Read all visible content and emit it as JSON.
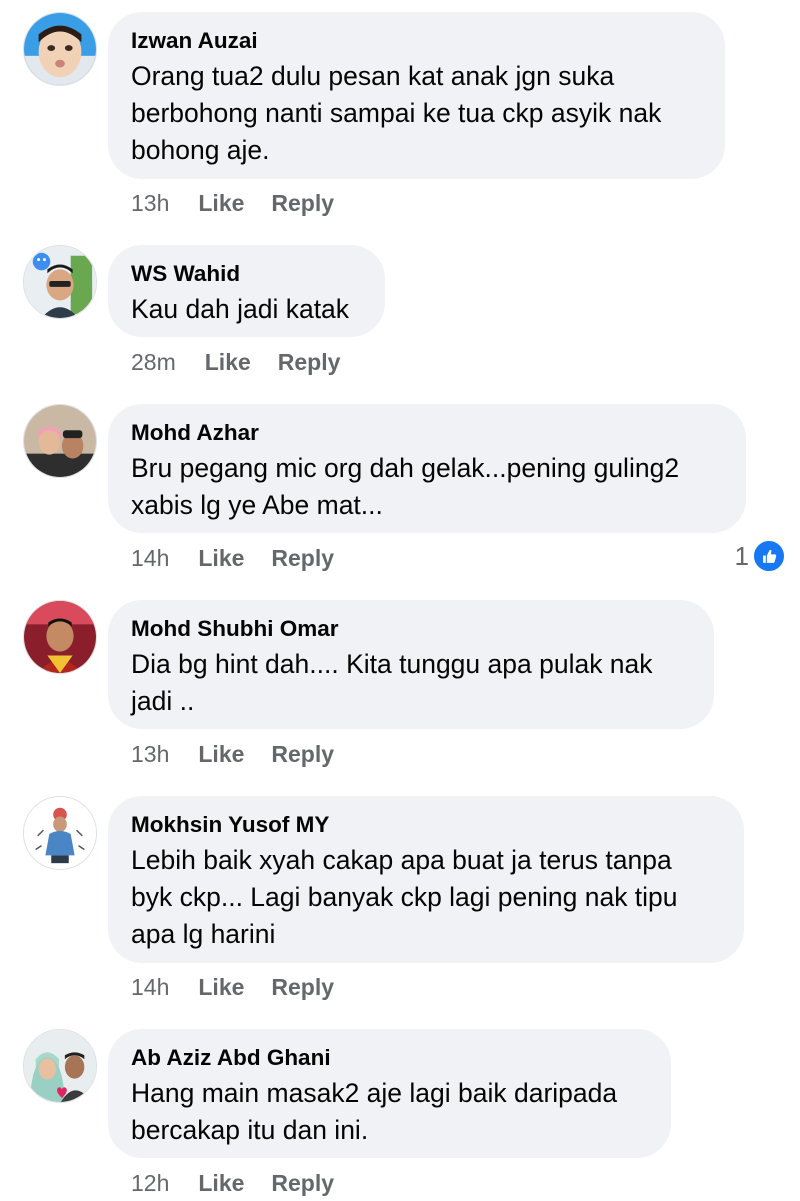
{
  "comments": [
    {
      "author": "Izwan Auzai",
      "lines": [
        "Orang tua2 dulu pesan kat anak jgn suka",
        "berbohong nanti sampai ke tua ckp asyik nak",
        "bohong aje."
      ],
      "time": "13h",
      "like_label": "Like",
      "reply_label": "Reply"
    },
    {
      "author": "WS Wahid",
      "lines": [
        "Kau dah jadi katak"
      ],
      "time": "28m",
      "like_label": "Like",
      "reply_label": "Reply"
    },
    {
      "author": "Mohd Azhar",
      "lines": [
        "Bru pegang mic org dah gelak...pening guling2",
        "xabis lg ye Abe mat..."
      ],
      "time": "14h",
      "like_label": "Like",
      "reply_label": "Reply",
      "reaction_count": "1",
      "reaction_icon": "thumbs-up-icon",
      "reaction_color": "#1877f2"
    },
    {
      "author": "Mohd Shubhi Omar",
      "lines": [
        "Dia bg hint dah.... Kita tunggu apa pulak nak",
        "jadi .."
      ],
      "time": "13h",
      "like_label": "Like",
      "reply_label": "Reply"
    },
    {
      "author": "Mokhsin Yusof MY",
      "lines": [
        "Lebih baik xyah cakap apa buat ja terus tanpa",
        "byk ckp... Lagi banyak ckp lagi pening nak tipu",
        "apa lg harini"
      ],
      "time": "14h",
      "like_label": "Like",
      "reply_label": "Reply"
    },
    {
      "author": "Ab Aziz Abd Ghani",
      "lines": [
        "Hang main masak2 aje lagi baik daripada",
        "bercakap itu dan ini."
      ],
      "time": "12h",
      "like_label": "Like",
      "reply_label": "Reply"
    }
  ],
  "colors": {
    "bubble": "#f0f2f5",
    "meta_text": "#65676b",
    "like_blue": "#1877f2"
  }
}
